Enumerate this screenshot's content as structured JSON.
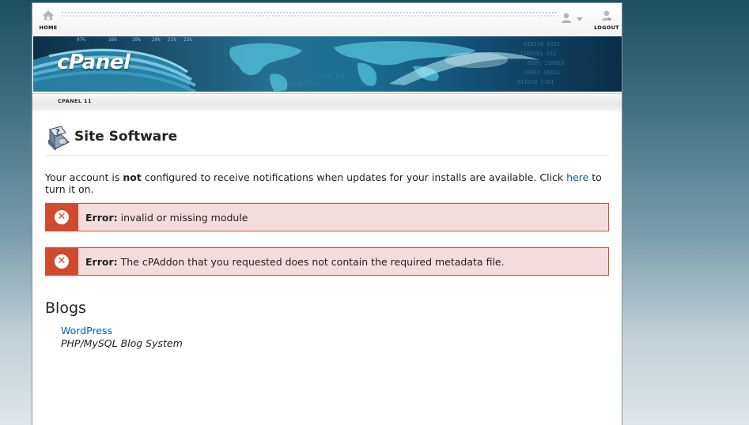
{
  "topbar": {
    "home_label": "HOME",
    "logout_label": "LOGOUT",
    "user_icon": "user-icon"
  },
  "banner": {
    "logo_text": "cPanel",
    "version_label": "CPANEL 11",
    "banner_numbers": [
      "97%",
      "16%",
      "19%",
      "20%",
      "21%",
      "22%"
    ]
  },
  "page": {
    "title": "Site Software",
    "icon": "software-book-icon"
  },
  "notice": {
    "prefix": "Your account is ",
    "emphasis": "not",
    "middle": " configured to receive notifications when updates for your installs are available. Click ",
    "link": "here",
    "suffix": " to turn it on."
  },
  "errors": [
    {
      "label": "Error:",
      "message": "invalid or missing module"
    },
    {
      "label": "Error:",
      "message": "The cPAddon that you requested does not contain the required metadata file."
    }
  ],
  "blogs": {
    "heading": "Blogs",
    "items": [
      {
        "name": "WordPress",
        "description": "PHP/MySQL Blog System"
      }
    ]
  },
  "colors": {
    "error_accent": "#d24a2e",
    "error_bg": "#f3dcdc",
    "link": "#125c99"
  }
}
